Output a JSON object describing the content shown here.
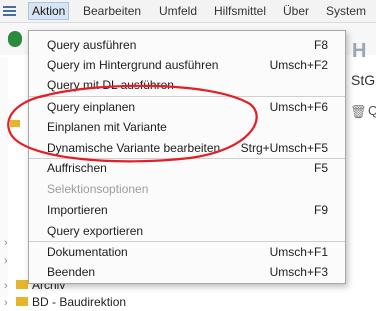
{
  "menubar": {
    "items": [
      {
        "label": "Aktion"
      },
      {
        "label": "Bearbeiten"
      },
      {
        "label": "Umfeld"
      },
      {
        "label": "Hilfsmittel"
      },
      {
        "label": "Über"
      },
      {
        "label": "System"
      }
    ]
  },
  "background": {
    "stg_text": "StG",
    "q_text": "Q",
    "tree": [
      {
        "label": "Archiv"
      },
      {
        "label": "BD - Baudirektion"
      }
    ]
  },
  "menu": {
    "items": [
      {
        "label": "Query ausführen",
        "shortcut": "F8"
      },
      {
        "label": "Query im Hintergrund ausführen",
        "shortcut": "Umsch+F2"
      },
      {
        "label": "Query mit DL ausführen",
        "shortcut": ""
      },
      {
        "label": "Query einplanen",
        "shortcut": "Umsch+F6"
      },
      {
        "label": "Einplanen mit Variante",
        "shortcut": ""
      },
      {
        "label": "Dynamische Variante bearbeiten",
        "shortcut": "Strg+Umsch+F5"
      },
      {
        "label": "Auffrischen",
        "shortcut": "F5"
      },
      {
        "label": "Selektionsoptionen",
        "shortcut": "",
        "disabled": true
      },
      {
        "label": "Importieren",
        "shortcut": "F9"
      },
      {
        "label": "Query exportieren",
        "shortcut": ""
      },
      {
        "label": "Dokumentation",
        "shortcut": "Umsch+F1"
      },
      {
        "label": "Beenden",
        "shortcut": "Umsch+F3"
      }
    ]
  },
  "colors": {
    "annotation": "#e41e26",
    "menu_highlight": "#d7e4f2",
    "folder": "#e8b52a"
  }
}
